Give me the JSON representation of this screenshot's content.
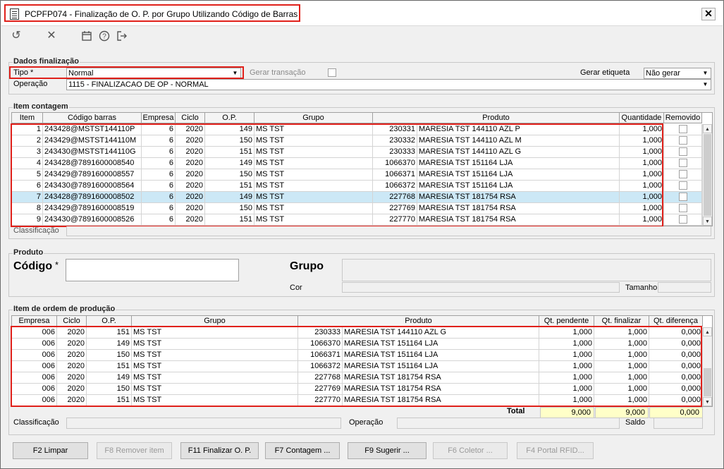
{
  "window": {
    "title": "PCPFP074 - Finalização de O. P.  por Grupo Utilizando Código de Barras",
    "close": "✕"
  },
  "toolbar": [
    "undo-icon",
    "cancel-icon",
    "calendar-icon",
    "help-icon",
    "exit-icon"
  ],
  "dados": {
    "legend": "Dados finalização",
    "tipo_label": "Tipo *",
    "tipo_value": "Normal",
    "gerar_transacao_label": "Gerar transação",
    "gerar_etiqueta_label": "Gerar etiqueta",
    "gerar_etiqueta_value": "Não gerar",
    "operacao_label": "Operação",
    "operacao_value": "1115 - FINALIZACAO DE OP - NORMAL"
  },
  "contagem": {
    "legend": "Item contagem",
    "headers": [
      "Item",
      "Código barras",
      "Empresa",
      "Ciclo",
      "O.P.",
      "Grupo",
      "Produto",
      "Quantidade",
      "Removido"
    ],
    "rows": [
      [
        "1",
        "243428@MSTST144110P",
        "6",
        "2020",
        "149",
        "MS TST",
        "230331",
        "MARESIA TST 144110 AZL P",
        "1,000"
      ],
      [
        "2",
        "243429@MSTST144110M",
        "6",
        "2020",
        "150",
        "MS TST",
        "230332",
        "MARESIA TST 144110 AZL M",
        "1,000"
      ],
      [
        "3",
        "243430@MSTST144110G",
        "6",
        "2020",
        "151",
        "MS TST",
        "230333",
        "MARESIA TST 144110 AZL G",
        "1,000"
      ],
      [
        "4",
        "243428@7891600008540",
        "6",
        "2020",
        "149",
        "MS TST",
        "1066370",
        "MARESIA TST 151164 LJA",
        "1,000"
      ],
      [
        "5",
        "243429@7891600008557",
        "6",
        "2020",
        "150",
        "MS TST",
        "1066371",
        "MARESIA TST 151164 LJA",
        "1,000"
      ],
      [
        "6",
        "243430@7891600008564",
        "6",
        "2020",
        "151",
        "MS TST",
        "1066372",
        "MARESIA TST 151164 LJA",
        "1,000"
      ],
      [
        "7",
        "243428@7891600008502",
        "6",
        "2020",
        "149",
        "MS TST",
        "227768",
        "MARESIA TST 181754 RSA",
        "1,000"
      ],
      [
        "8",
        "243429@7891600008519",
        "6",
        "2020",
        "150",
        "MS TST",
        "227769",
        "MARESIA TST 181754 RSA",
        "1,000"
      ],
      [
        "9",
        "243430@7891600008526",
        "6",
        "2020",
        "151",
        "MS TST",
        "227770",
        "MARESIA TST 181754 RSA",
        "1,000"
      ]
    ],
    "classificacao_label": "Classificação"
  },
  "produto": {
    "legend": "Produto",
    "codigo_label": "Código",
    "codigo_req": "*",
    "grupo_label": "Grupo",
    "cor_label": "Cor",
    "tamanho_label": "Tamanho"
  },
  "ordem": {
    "legend": "Item de ordem de produção",
    "headers": [
      "Empresa",
      "Ciclo",
      "O.P.",
      "Grupo",
      "Produto",
      "Qt. pendente",
      "Qt. finalizar",
      "Qt. diferença"
    ],
    "rows": [
      [
        "006",
        "2020",
        "151",
        "MS TST",
        "230333",
        "MARESIA TST 144110 AZL G",
        "1,000",
        "1,000",
        "0,000"
      ],
      [
        "006",
        "2020",
        "149",
        "MS TST",
        "1066370",
        "MARESIA TST 151164 LJA",
        "1,000",
        "1,000",
        "0,000"
      ],
      [
        "006",
        "2020",
        "150",
        "MS TST",
        "1066371",
        "MARESIA TST 151164 LJA",
        "1,000",
        "1,000",
        "0,000"
      ],
      [
        "006",
        "2020",
        "151",
        "MS TST",
        "1066372",
        "MARESIA TST 151164 LJA",
        "1,000",
        "1,000",
        "0,000"
      ],
      [
        "006",
        "2020",
        "149",
        "MS TST",
        "227768",
        "MARESIA TST 181754 RSA",
        "1,000",
        "1,000",
        "0,000"
      ],
      [
        "006",
        "2020",
        "150",
        "MS TST",
        "227769",
        "MARESIA TST 181754 RSA",
        "1,000",
        "1,000",
        "0,000"
      ],
      [
        "006",
        "2020",
        "151",
        "MS TST",
        "227770",
        "MARESIA TST 181754 RSA",
        "1,000",
        "1,000",
        "0,000"
      ]
    ],
    "total_label": "Total",
    "total_pendente": "9,000",
    "total_finalizar": "9,000",
    "total_diferenca": "0,000",
    "classificacao_label": "Classificação",
    "operacao_label": "Operação",
    "saldo_label": "Saldo"
  },
  "buttons": {
    "limpar": "F2 Limpar",
    "remover": "F8 Remover item",
    "finalizar": "F11 Finalizar O. P.",
    "contagem": "F7 Contagem ...",
    "sugerir": "F9 Sugerir ...",
    "coletor": "F6 Coletor ...",
    "portal": "F4 Portal RFID..."
  },
  "colors": {
    "highlight": "#e0201a",
    "selected_row": "#cce8f6",
    "total_bg": "#ffffc8"
  }
}
